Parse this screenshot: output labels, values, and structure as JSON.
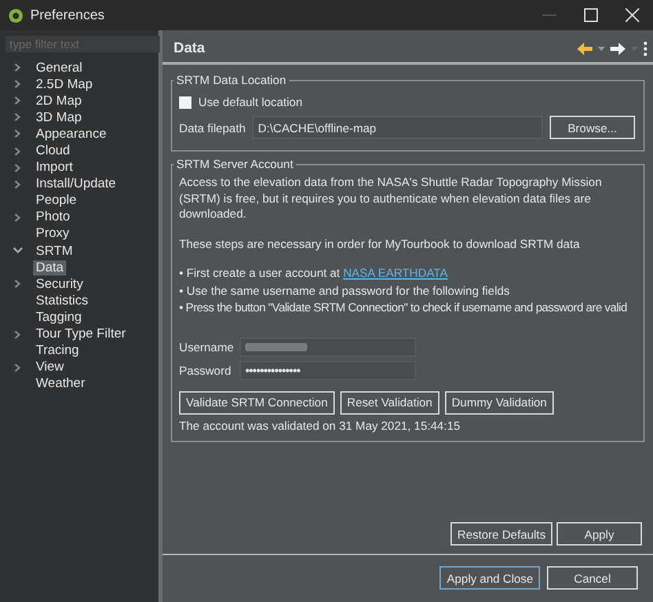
{
  "window": {
    "title": "Preferences"
  },
  "filter": {
    "placeholder": "type filter text"
  },
  "tree": [
    {
      "label": "General",
      "expanded": false,
      "selected": false
    },
    {
      "label": "2.5D Map",
      "expanded": false,
      "selected": false
    },
    {
      "label": "2D Map",
      "expanded": false,
      "selected": false
    },
    {
      "label": "3D Map",
      "expanded": false,
      "selected": false
    },
    {
      "label": "Appearance",
      "expanded": false,
      "selected": false
    },
    {
      "label": "Cloud",
      "expanded": false,
      "selected": false
    },
    {
      "label": "Import",
      "expanded": false,
      "selected": false
    },
    {
      "label": "Install/Update",
      "expanded": false,
      "selected": false
    },
    {
      "label": "People",
      "selected": false
    },
    {
      "label": "Photo",
      "expanded": false,
      "selected": false
    },
    {
      "label": "Proxy",
      "selected": false
    },
    {
      "label": "SRTM",
      "expanded": true,
      "selected": false,
      "children": [
        {
          "label": "Data",
          "selected": true
        }
      ]
    },
    {
      "label": "Security",
      "expanded": false,
      "selected": false
    },
    {
      "label": "Statistics",
      "selected": false
    },
    {
      "label": "Tagging",
      "selected": false
    },
    {
      "label": "Tour Type Filter",
      "expanded": false,
      "selected": false
    },
    {
      "label": "Tracing",
      "selected": false
    },
    {
      "label": "View",
      "expanded": false,
      "selected": false
    },
    {
      "label": "Weather",
      "selected": false
    }
  ],
  "page": {
    "title": "Data"
  },
  "location_group": {
    "title": "SRTM Data Location",
    "use_default": {
      "label": "Use default location",
      "checked": false
    },
    "filepath_label": "Data filepath",
    "filepath": "D:\\CACHE\\offline-map",
    "browse": "Browse..."
  },
  "account_group": {
    "title": "SRTM Server Account",
    "intro": "Access to the elevation data from the NASA's Shuttle Radar Topography Mission (SRTM) is free, but it requires you to authenticate when elevation data files are downloaded.",
    "steps_note": "These steps are necessary in order for MyTourbook to download SRTM data",
    "bullet_1": "• First create a user account at",
    "link": "NASA EARTHDATA",
    "bullet_2": "• Use the same username and password for the following fields",
    "bullet_3": "• Press the button \"Validate SRTM Connection\" to check if username and password are valid",
    "username_label": "Username",
    "password_label": "Password",
    "password": "•••••••••••••••",
    "buttons": [
      "Validate SRTM Connection",
      "Reset Validation",
      "Dummy Validation"
    ],
    "status": "The account was validated on 31 May 2021, 15:44:15"
  },
  "page_buttons": [
    "Restore Defaults",
    "Apply"
  ],
  "dialog_buttons": [
    {
      "label": "Apply and Close",
      "default": true
    },
    {
      "label": "Cancel",
      "default": false
    }
  ]
}
